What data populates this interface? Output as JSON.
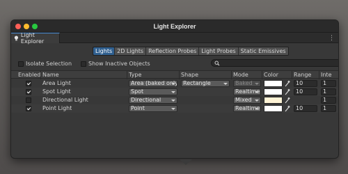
{
  "window": {
    "title": "Light Explorer"
  },
  "tab": {
    "label": "Light Explorer",
    "icon": "light-bulb-icon"
  },
  "segments": [
    {
      "label": "Lights",
      "active": true
    },
    {
      "label": "2D Lights",
      "active": false
    },
    {
      "label": "Reflection Probes",
      "active": false
    },
    {
      "label": "Light Probes",
      "active": false
    },
    {
      "label": "Static Emissives",
      "active": false
    }
  ],
  "options": {
    "isolate_label": "Isolate Selection",
    "show_inactive_label": "Show Inactive Objects",
    "search_icon": "search-icon"
  },
  "columns": [
    "Enabled",
    "Name",
    "Type",
    "Shape",
    "Mode",
    "Color",
    "Range",
    "Inte"
  ],
  "rows": [
    {
      "enabled": true,
      "name": "Area Light",
      "type": "Area (baked only)",
      "shape": "Rectangle",
      "mode": "Baked",
      "color": "#ffffff",
      "range": "10",
      "intensity": "1"
    },
    {
      "enabled": true,
      "name": "Spot Light",
      "type": "Spot",
      "shape": "",
      "mode": "Realtime",
      "color": "#ffffff",
      "range": "10",
      "intensity": "1"
    },
    {
      "enabled": false,
      "name": "Directional Light",
      "type": "Directional",
      "shape": "",
      "mode": "Mixed",
      "color": "#fff4d6",
      "range": "",
      "intensity": "1"
    },
    {
      "enabled": true,
      "name": "Point Light",
      "type": "Point",
      "shape": "",
      "mode": "Realtime",
      "color": "#ffffff",
      "range": "10",
      "intensity": "1"
    }
  ],
  "colors": {
    "accent": "#2f5f8f",
    "window_bg": "#383838"
  }
}
